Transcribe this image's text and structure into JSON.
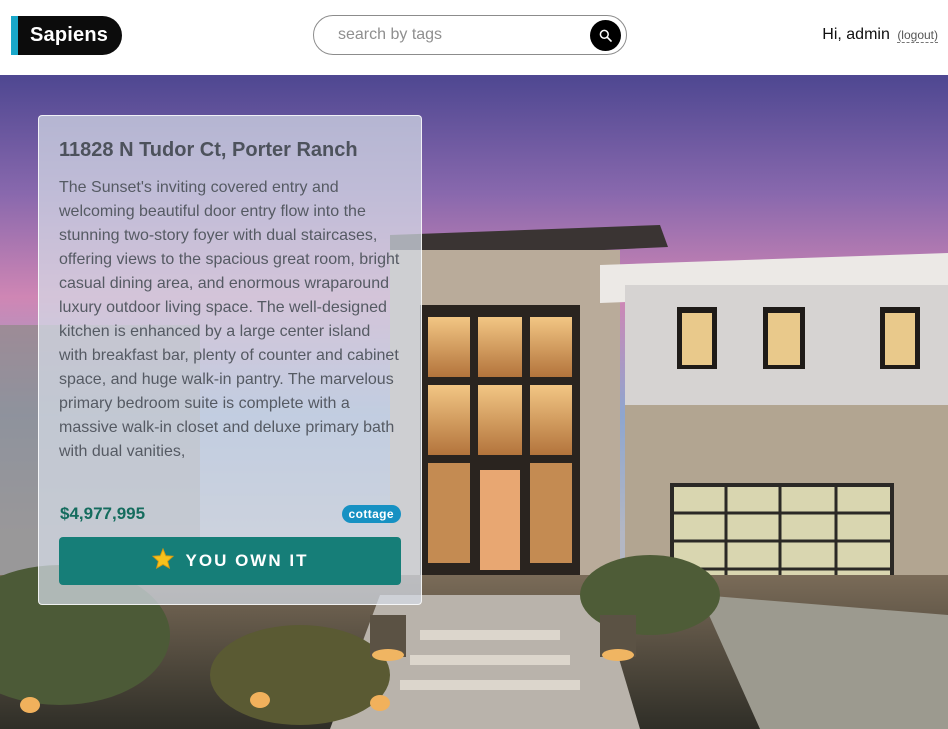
{
  "brand": {
    "name": "Sapiens"
  },
  "search": {
    "placeholder": "search by tags"
  },
  "user": {
    "greeting": "Hi, admin",
    "logout": "(logout)"
  },
  "listing": {
    "title": "11828 N Tudor Ct, Porter Ranch",
    "description": "The Sunset's inviting covered entry and welcoming beautiful door entry flow into the stunning two-story foyer with dual staircases, offering views to the spacious great room, bright casual dining area, and enormous wraparound luxury outdoor living space. The well-designed kitchen is enhanced by a large center island with breakfast bar, plenty of counter and cabinet space, and huge walk-in pantry. The marvelous primary bedroom suite is complete with a massive walk-in closet and deluxe primary bath with dual vanities,",
    "price": "$4,977,995",
    "tag": "cottage",
    "action_label": "YOU OWN IT"
  },
  "colors": {
    "brand_accent": "#19a7c9",
    "button": "#167e78",
    "price": "#156c5e",
    "tag": "#1691c3"
  },
  "icons": {
    "search": "search-icon",
    "action": "star-icon"
  }
}
